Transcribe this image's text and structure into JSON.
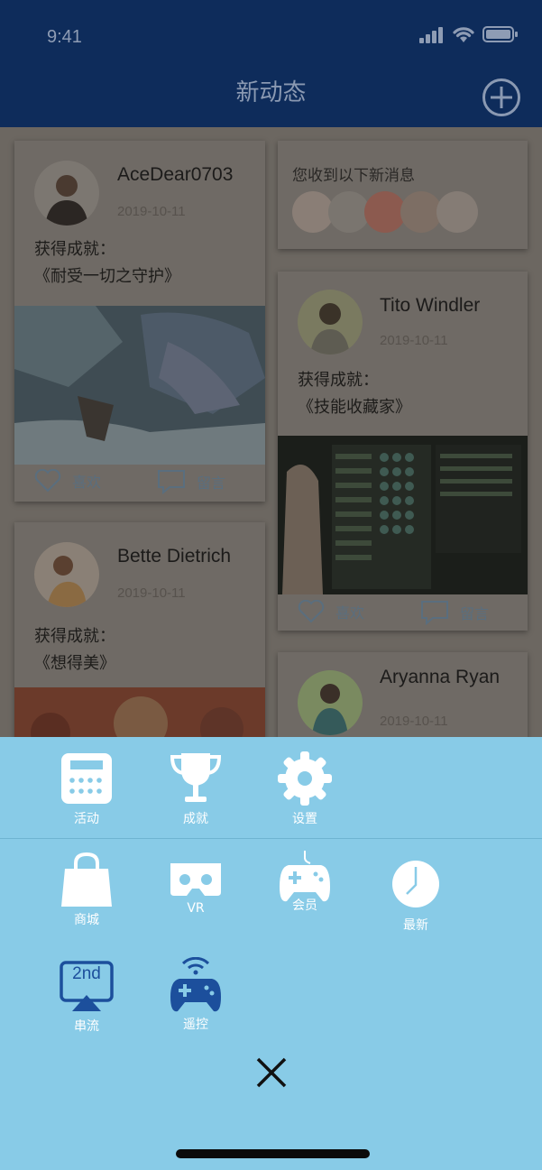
{
  "status_bar": {
    "time": "9:41"
  },
  "nav": {
    "title": "新动态"
  },
  "feed": {
    "posts": [
      {
        "username": "AceDear0703",
        "date": "2019-10-11",
        "achievement_label": "获得成就：",
        "achievement_name": "《耐受一切之守护》",
        "like_label": "喜欢",
        "comment_label": "留言"
      },
      {
        "username": "Tito Windler",
        "date": "2019-10-11",
        "achievement_label": "获得成就：",
        "achievement_name": "《技能收藏家》",
        "like_label": "喜欢",
        "comment_label": "留言"
      },
      {
        "username": "Bette Dietrich",
        "date": "2019-10-11",
        "achievement_label": "获得成就：",
        "achievement_name": "《想得美》"
      },
      {
        "username": "Aryanna Ryan",
        "date": "2019-10-11"
      }
    ],
    "notification": {
      "title": "您收到以下新消息"
    }
  },
  "menu": {
    "row1": [
      {
        "label": "活动",
        "icon": "calendar-icon"
      },
      {
        "label": "成就",
        "icon": "trophy-icon"
      },
      {
        "label": "设置",
        "icon": "gear-icon"
      }
    ],
    "row2": [
      {
        "label": "商城",
        "icon": "shopping-bag-icon"
      },
      {
        "label": "VR",
        "icon": "vr-headset-icon"
      },
      {
        "label": "会员",
        "icon": "gamepad-icon"
      },
      {
        "label": "最新",
        "icon": "clock-icon"
      }
    ],
    "row3": [
      {
        "label": "串流",
        "icon": "second-screen-icon",
        "badge": "2nd"
      },
      {
        "label": "遥控",
        "icon": "wireless-gamepad-icon"
      }
    ]
  },
  "colors": {
    "header": "#0e2c5b",
    "menu_bg": "#88cbe7",
    "dim_feed": "#6c6761",
    "icon_blue": "#1c4f9c"
  }
}
